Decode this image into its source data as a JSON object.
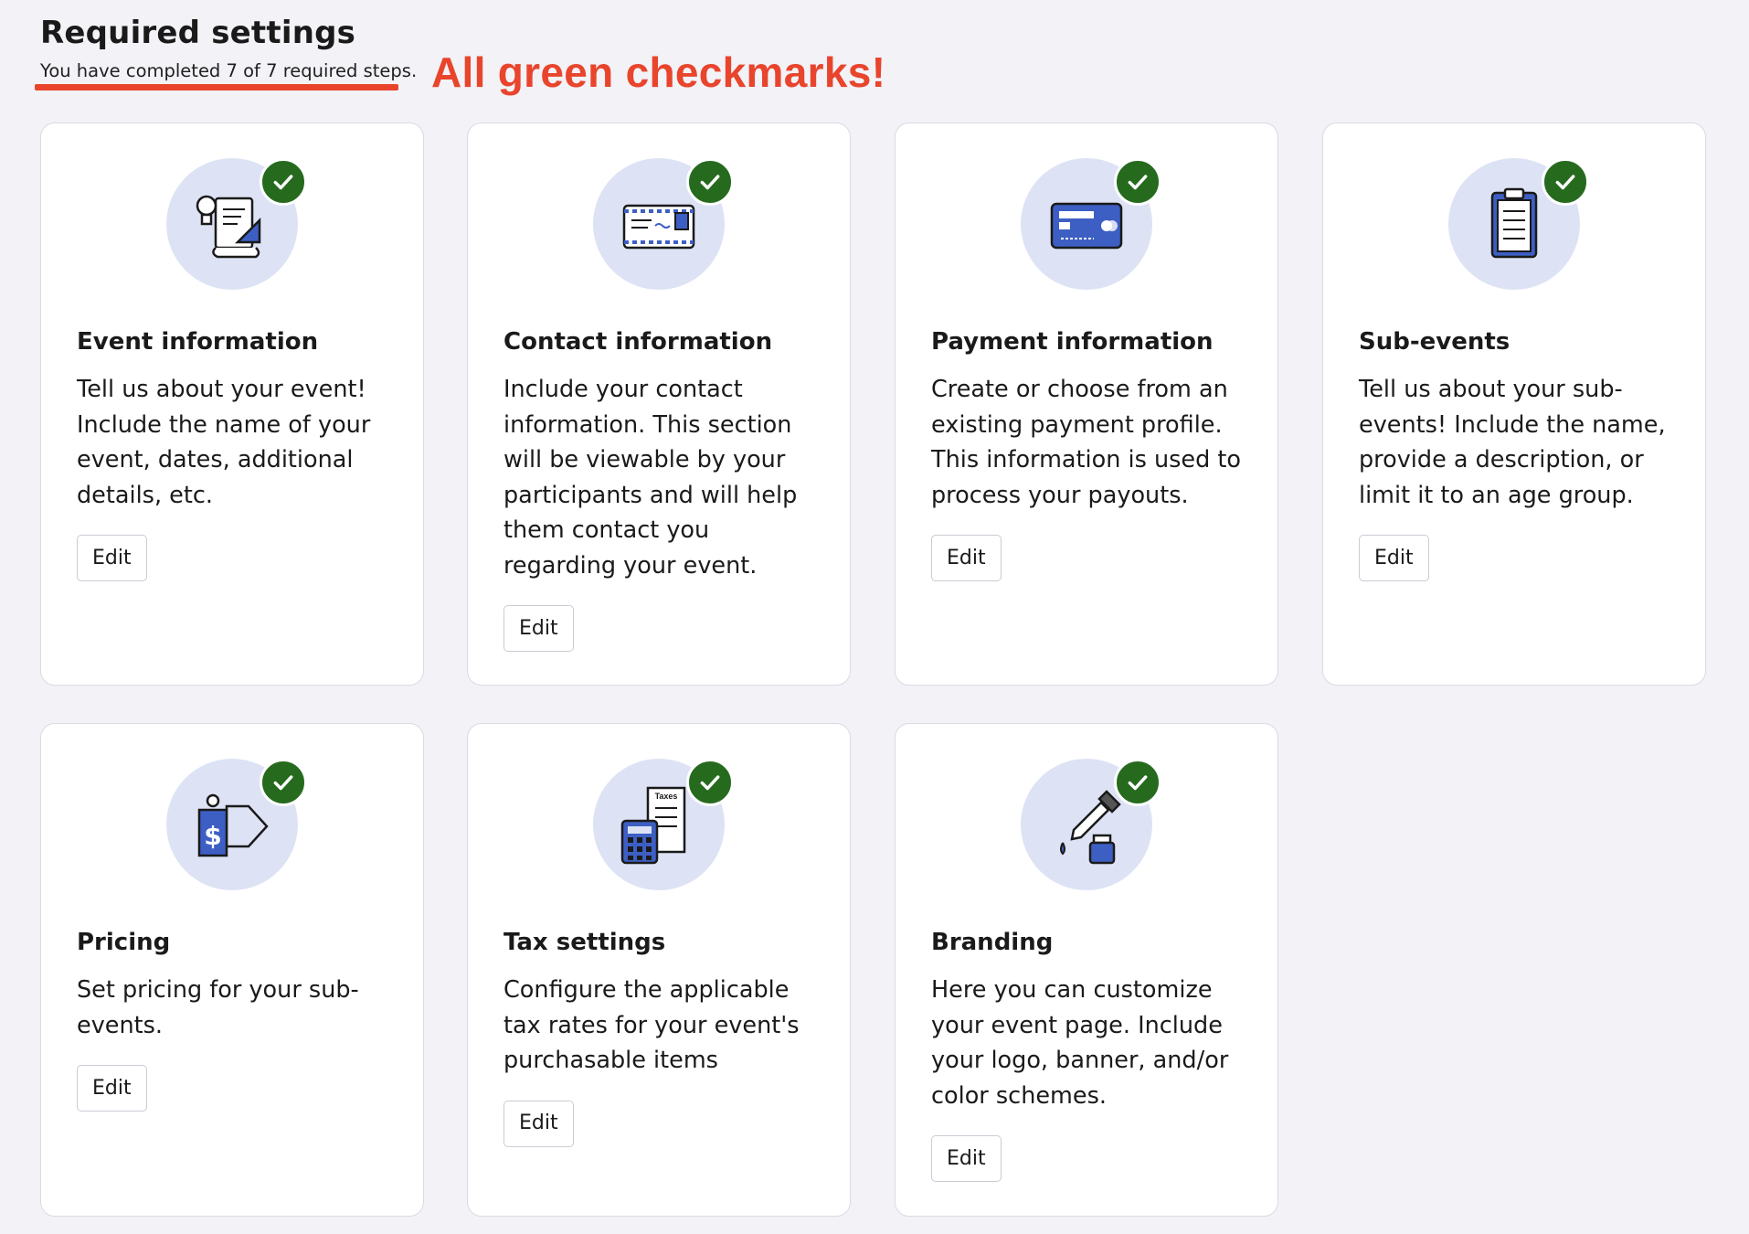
{
  "header": {
    "title": "Required settings",
    "progress_text": "You have completed 7 of 7 required steps.",
    "annotation": "All green checkmarks!"
  },
  "colors": {
    "background": "#f2f2f7",
    "annotation": "#e8452c",
    "check_badge": "#266a1e",
    "icon_circle": "#dde3f5",
    "icon_accent": "#3d5fc4"
  },
  "cards": [
    {
      "title": "Event information",
      "description": "Tell us about your event! Include the name of your event, dates, additional details, etc.",
      "edit_label": "Edit",
      "icon": "lightbulb-document-icon",
      "completed": true
    },
    {
      "title": "Contact information",
      "description": "Include your contact information. This section will be viewable by your participants and will help them contact you regarding your event.",
      "edit_label": "Edit",
      "icon": "envelope-icon",
      "completed": true
    },
    {
      "title": "Payment information",
      "description": "Create or choose from an existing payment profile. This information is used to process your payouts.",
      "edit_label": "Edit",
      "icon": "credit-card-icon",
      "completed": true
    },
    {
      "title": "Sub-events",
      "description": "Tell us about your sub-events! Include the name, provide a description, or limit it to an age group.",
      "edit_label": "Edit",
      "icon": "clipboard-icon",
      "completed": true
    },
    {
      "title": "Pricing",
      "description": "Set pricing for your sub-events.",
      "edit_label": "Edit",
      "icon": "price-tag-icon",
      "completed": true
    },
    {
      "title": "Tax settings",
      "description": "Configure the applicable tax rates for your event's purchasable items",
      "edit_label": "Edit",
      "icon": "calculator-receipt-icon",
      "completed": true,
      "icon_label": "Taxes"
    },
    {
      "title": "Branding",
      "description": "Here you can customize your event page. Include your logo, banner, and/or color schemes.",
      "edit_label": "Edit",
      "icon": "eyedropper-icon",
      "completed": true
    }
  ]
}
